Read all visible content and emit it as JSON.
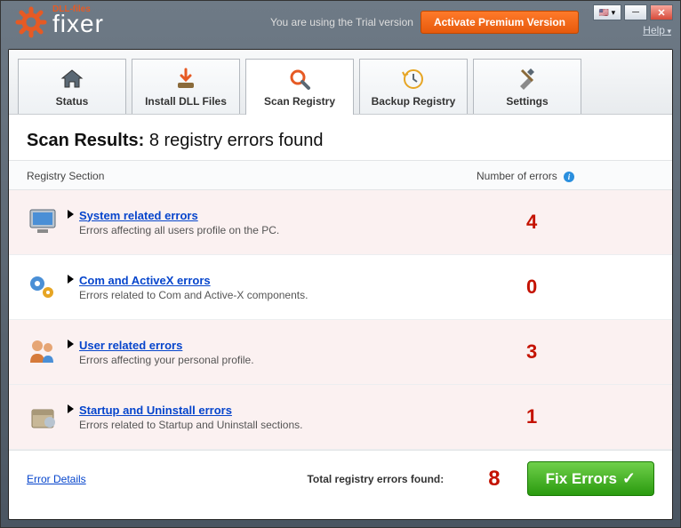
{
  "header": {
    "brand_small": "DLL-files",
    "brand_main": "fixer",
    "trial_text": "You are using the Trial version",
    "activate_label": "Activate Premium Version",
    "help_label": "Help"
  },
  "tabs": [
    {
      "id": "status",
      "label": "Status"
    },
    {
      "id": "install",
      "label": "Install DLL Files"
    },
    {
      "id": "scan",
      "label": "Scan Registry"
    },
    {
      "id": "backup",
      "label": "Backup Registry"
    },
    {
      "id": "settings",
      "label": "Settings"
    }
  ],
  "active_tab": "scan",
  "results": {
    "title_bold": "Scan Results:",
    "title_rest": "8 registry errors found",
    "col1": "Registry Section",
    "col2": "Number of errors",
    "rows": [
      {
        "icon": "monitor",
        "title": "System related errors",
        "desc": "Errors affecting all users profile on the PC.",
        "count": 4,
        "has_err": true
      },
      {
        "icon": "gears",
        "title": "Com and ActiveX errors",
        "desc": "Errors related to Com and Active-X components.",
        "count": 0,
        "has_err": false
      },
      {
        "icon": "users",
        "title": "User related errors",
        "desc": "Errors affecting your personal profile.",
        "count": 3,
        "has_err": true
      },
      {
        "icon": "box",
        "title": "Startup and Uninstall errors",
        "desc": "Errors related to Startup and Uninstall sections.",
        "count": 1,
        "has_err": true
      }
    ],
    "error_details_label": "Error Details",
    "total_label": "Total registry errors found:",
    "total_count": 8,
    "fix_label": "Fix Errors"
  }
}
